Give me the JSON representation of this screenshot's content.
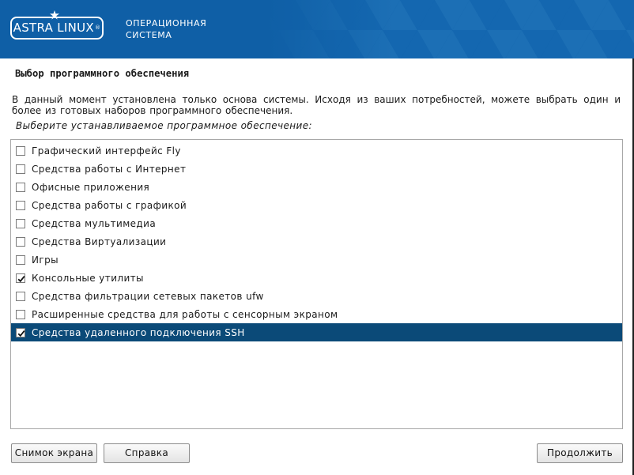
{
  "header": {
    "logo_text": "ASTRA LINUX",
    "logo_mark": "®",
    "subtitle_line1": "ОПЕРАЦИОННАЯ",
    "subtitle_line2": "СИСТЕМА",
    "banner_color": "#0f5fa6"
  },
  "page": {
    "title": "Выбор программного обеспечения",
    "description": "В данный момент установлена только основа системы. Исходя из ваших потребностей, можете выбрать один и более из готовых наборов программного обеспечения.",
    "prompt": "Выберите устанавливаемое программное обеспечение:"
  },
  "software_list": {
    "items": [
      {
        "label": "Графический интерфейс Fly",
        "checked": false,
        "selected": false
      },
      {
        "label": "Средства работы с Интернет",
        "checked": false,
        "selected": false
      },
      {
        "label": "Офисные приложения",
        "checked": false,
        "selected": false
      },
      {
        "label": "Средства работы с графикой",
        "checked": false,
        "selected": false
      },
      {
        "label": "Средства мультимедиа",
        "checked": false,
        "selected": false
      },
      {
        "label": "Средства Виртуализации",
        "checked": false,
        "selected": false
      },
      {
        "label": "Игры",
        "checked": false,
        "selected": false
      },
      {
        "label": "Консольные утилиты",
        "checked": true,
        "selected": false
      },
      {
        "label": "Средства фильтрации сетевых пакетов ufw",
        "checked": false,
        "selected": false
      },
      {
        "label": "Расширенные средства для работы с сенсорным экраном",
        "checked": false,
        "selected": false
      },
      {
        "label": "Средства удаленного подключения SSH",
        "checked": true,
        "selected": true
      }
    ],
    "selection_color": "#0b4a78"
  },
  "buttons": {
    "screenshot": "Снимок экрана",
    "help": "Справка",
    "continue": "Продолжить"
  }
}
